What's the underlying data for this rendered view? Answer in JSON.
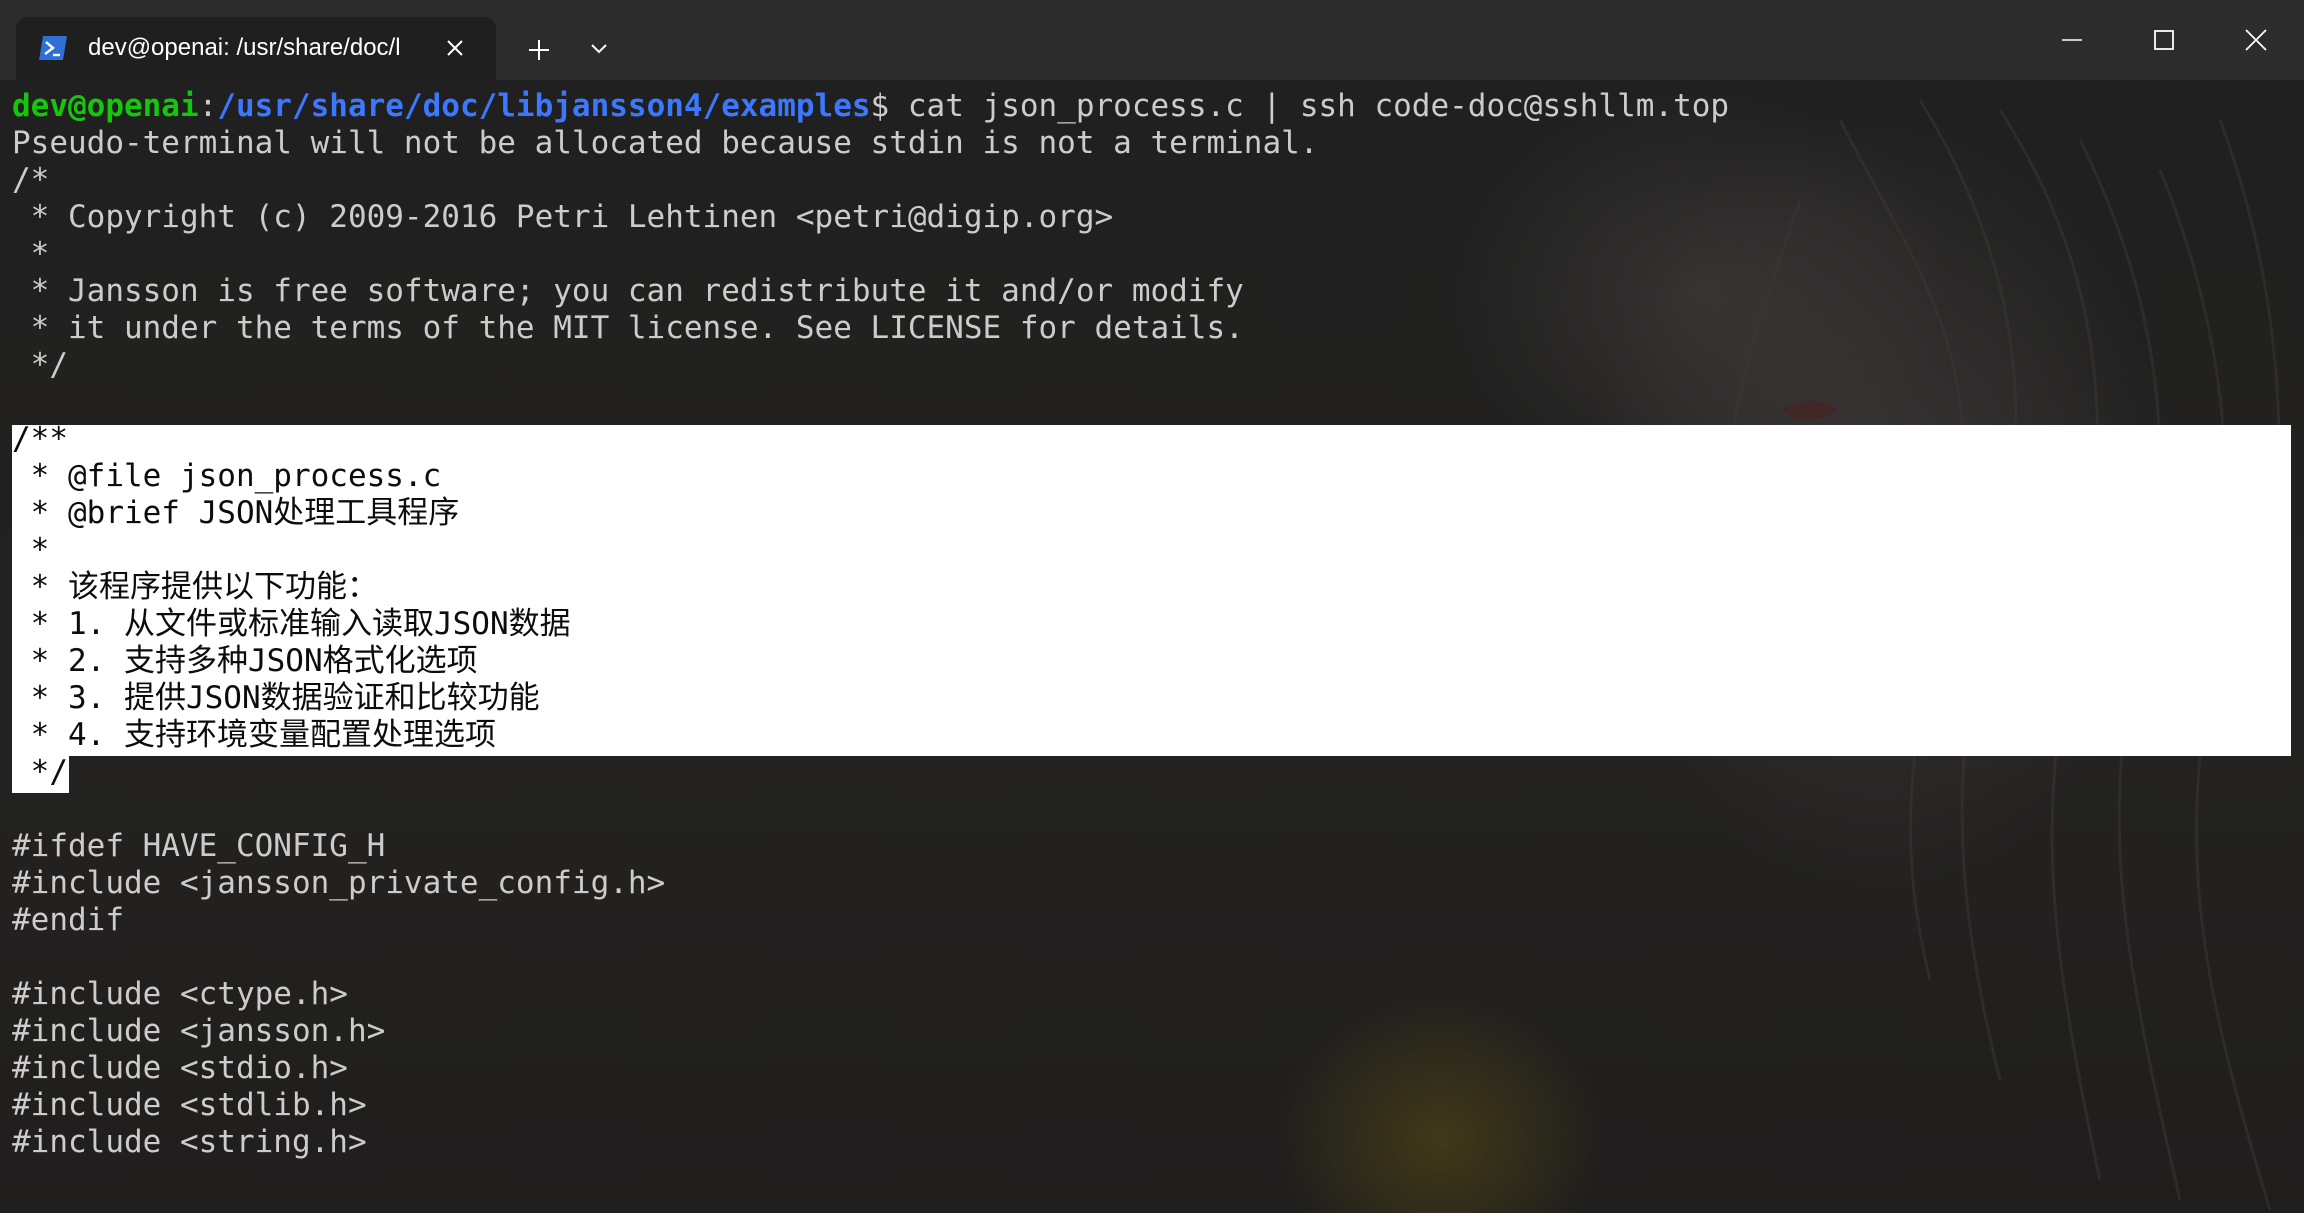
{
  "window": {
    "tab_title": "dev@openai: /usr/share/doc/l",
    "icons": {
      "tab": "powershell-icon",
      "close_tab": "close-icon",
      "new_tab": "plus-icon",
      "dropdown": "chevron-down-icon",
      "minimize": "minimize-icon",
      "maximize": "maximize-icon",
      "close_window": "close-icon"
    }
  },
  "prompt": {
    "user": "dev@openai",
    "colon": ":",
    "path": "/usr/share/doc/libjansson4/examples",
    "dollar": "$",
    "command": " cat json_process.c | ssh code-doc@sshllm.top"
  },
  "colors": {
    "prompt_user": "#16c60c",
    "prompt_path": "#3b78ff",
    "text": "#cccccc",
    "selection": "#ffffff"
  },
  "output_lines": [
    "Pseudo-terminal will not be allocated because stdin is not a terminal.",
    "/*",
    " * Copyright (c) 2009-2016 Petri Lehtinen <petri@digip.org>",
    " *",
    " * Jansson is free software; you can redistribute it and/or modify",
    " * it under the terms of the MIT license. See LICENSE for details.",
    " */",
    "",
    "/**",
    " * @file json_process.c",
    " * @brief JSON处理工具程序",
    " *",
    " * 该程序提供以下功能：",
    " * 1. 从文件或标准输入读取JSON数据",
    " * 2. 支持多种JSON格式化选项",
    " * 3. 提供JSON数据验证和比较功能",
    " * 4. 支持环境变量配置处理选项",
    " */",
    "",
    "#ifdef HAVE_CONFIG_H",
    "#include <jansson_private_config.h>",
    "#endif",
    "",
    "#include <ctype.h>",
    "#include <jansson.h>",
    "#include <stdio.h>",
    "#include <stdlib.h>",
    "#include <string.h>"
  ]
}
